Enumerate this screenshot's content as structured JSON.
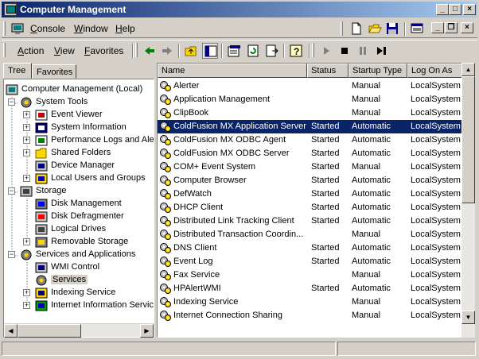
{
  "window": {
    "title": "Computer Management"
  },
  "menubar": {
    "console": "Console",
    "window": "Window",
    "help": "Help"
  },
  "actionbar": {
    "action": "Action",
    "view": "View",
    "favorites": "Favorites"
  },
  "tabs": {
    "tree": "Tree",
    "favorites": "Favorites"
  },
  "tree": [
    {
      "label": "Computer Management (Local)",
      "icon": "computer-icon",
      "indent": 0,
      "expander": ""
    },
    {
      "label": "System Tools",
      "icon": "tools-icon",
      "indent": 1,
      "expander": "−"
    },
    {
      "label": "Event Viewer",
      "icon": "event-viewer-icon",
      "indent": 2,
      "expander": "+"
    },
    {
      "label": "System Information",
      "icon": "info-icon",
      "indent": 2,
      "expander": "+"
    },
    {
      "label": "Performance Logs and Alerts",
      "icon": "perf-icon",
      "indent": 2,
      "expander": "+"
    },
    {
      "label": "Shared Folders",
      "icon": "folder-icon",
      "indent": 2,
      "expander": "+"
    },
    {
      "label": "Device Manager",
      "icon": "device-icon",
      "indent": 2,
      "expander": ""
    },
    {
      "label": "Local Users and Groups",
      "icon": "users-icon",
      "indent": 2,
      "expander": "+"
    },
    {
      "label": "Storage",
      "icon": "storage-icon",
      "indent": 1,
      "expander": "−"
    },
    {
      "label": "Disk Management",
      "icon": "disk-icon",
      "indent": 2,
      "expander": ""
    },
    {
      "label": "Disk Defragmenter",
      "icon": "defrag-icon",
      "indent": 2,
      "expander": ""
    },
    {
      "label": "Logical Drives",
      "icon": "drive-icon",
      "indent": 2,
      "expander": ""
    },
    {
      "label": "Removable Storage",
      "icon": "removable-icon",
      "indent": 2,
      "expander": "+"
    },
    {
      "label": "Services and Applications",
      "icon": "services-apps-icon",
      "indent": 1,
      "expander": "−"
    },
    {
      "label": "WMI Control",
      "icon": "wmi-icon",
      "indent": 2,
      "expander": ""
    },
    {
      "label": "Services",
      "icon": "gear-icon",
      "indent": 2,
      "expander": "",
      "selected": true
    },
    {
      "label": "Indexing Service",
      "icon": "index-icon",
      "indent": 2,
      "expander": "+"
    },
    {
      "label": "Internet Information Services",
      "icon": "iis-icon",
      "indent": 2,
      "expander": "+"
    }
  ],
  "columns": [
    "Name",
    "Status",
    "Startup Type",
    "Log On As"
  ],
  "services": [
    {
      "name": "Alerter",
      "status": "",
      "startup": "Manual",
      "logon": "LocalSystem"
    },
    {
      "name": "Application Management",
      "status": "",
      "startup": "Manual",
      "logon": "LocalSystem"
    },
    {
      "name": "ClipBook",
      "status": "",
      "startup": "Manual",
      "logon": "LocalSystem"
    },
    {
      "name": "ColdFusion MX Application Server",
      "status": "Started",
      "startup": "Automatic",
      "logon": "LocalSystem",
      "selected": true
    },
    {
      "name": "ColdFusion MX ODBC Agent",
      "status": "Started",
      "startup": "Automatic",
      "logon": "LocalSystem"
    },
    {
      "name": "ColdFusion MX ODBC Server",
      "status": "Started",
      "startup": "Automatic",
      "logon": "LocalSystem"
    },
    {
      "name": "COM+ Event System",
      "status": "Started",
      "startup": "Manual",
      "logon": "LocalSystem"
    },
    {
      "name": "Computer Browser",
      "status": "Started",
      "startup": "Automatic",
      "logon": "LocalSystem"
    },
    {
      "name": "DefWatch",
      "status": "Started",
      "startup": "Automatic",
      "logon": "LocalSystem"
    },
    {
      "name": "DHCP Client",
      "status": "Started",
      "startup": "Automatic",
      "logon": "LocalSystem"
    },
    {
      "name": "Distributed Link Tracking Client",
      "status": "Started",
      "startup": "Automatic",
      "logon": "LocalSystem"
    },
    {
      "name": "Distributed Transaction Coordin...",
      "status": "",
      "startup": "Manual",
      "logon": "LocalSystem"
    },
    {
      "name": "DNS Client",
      "status": "Started",
      "startup": "Automatic",
      "logon": "LocalSystem"
    },
    {
      "name": "Event Log",
      "status": "Started",
      "startup": "Automatic",
      "logon": "LocalSystem"
    },
    {
      "name": "Fax Service",
      "status": "",
      "startup": "Manual",
      "logon": "LocalSystem"
    },
    {
      "name": "HPAlertWMI",
      "status": "Started",
      "startup": "Automatic",
      "logon": "LocalSystem"
    },
    {
      "name": "Indexing Service",
      "status": "",
      "startup": "Manual",
      "logon": "LocalSystem"
    },
    {
      "name": "Internet Connection Sharing",
      "status": "",
      "startup": "Manual",
      "logon": "LocalSystem"
    }
  ],
  "colors": {
    "selection": "#0a246a",
    "titlebar": "#0a246a",
    "face": "#d4d0c8"
  }
}
